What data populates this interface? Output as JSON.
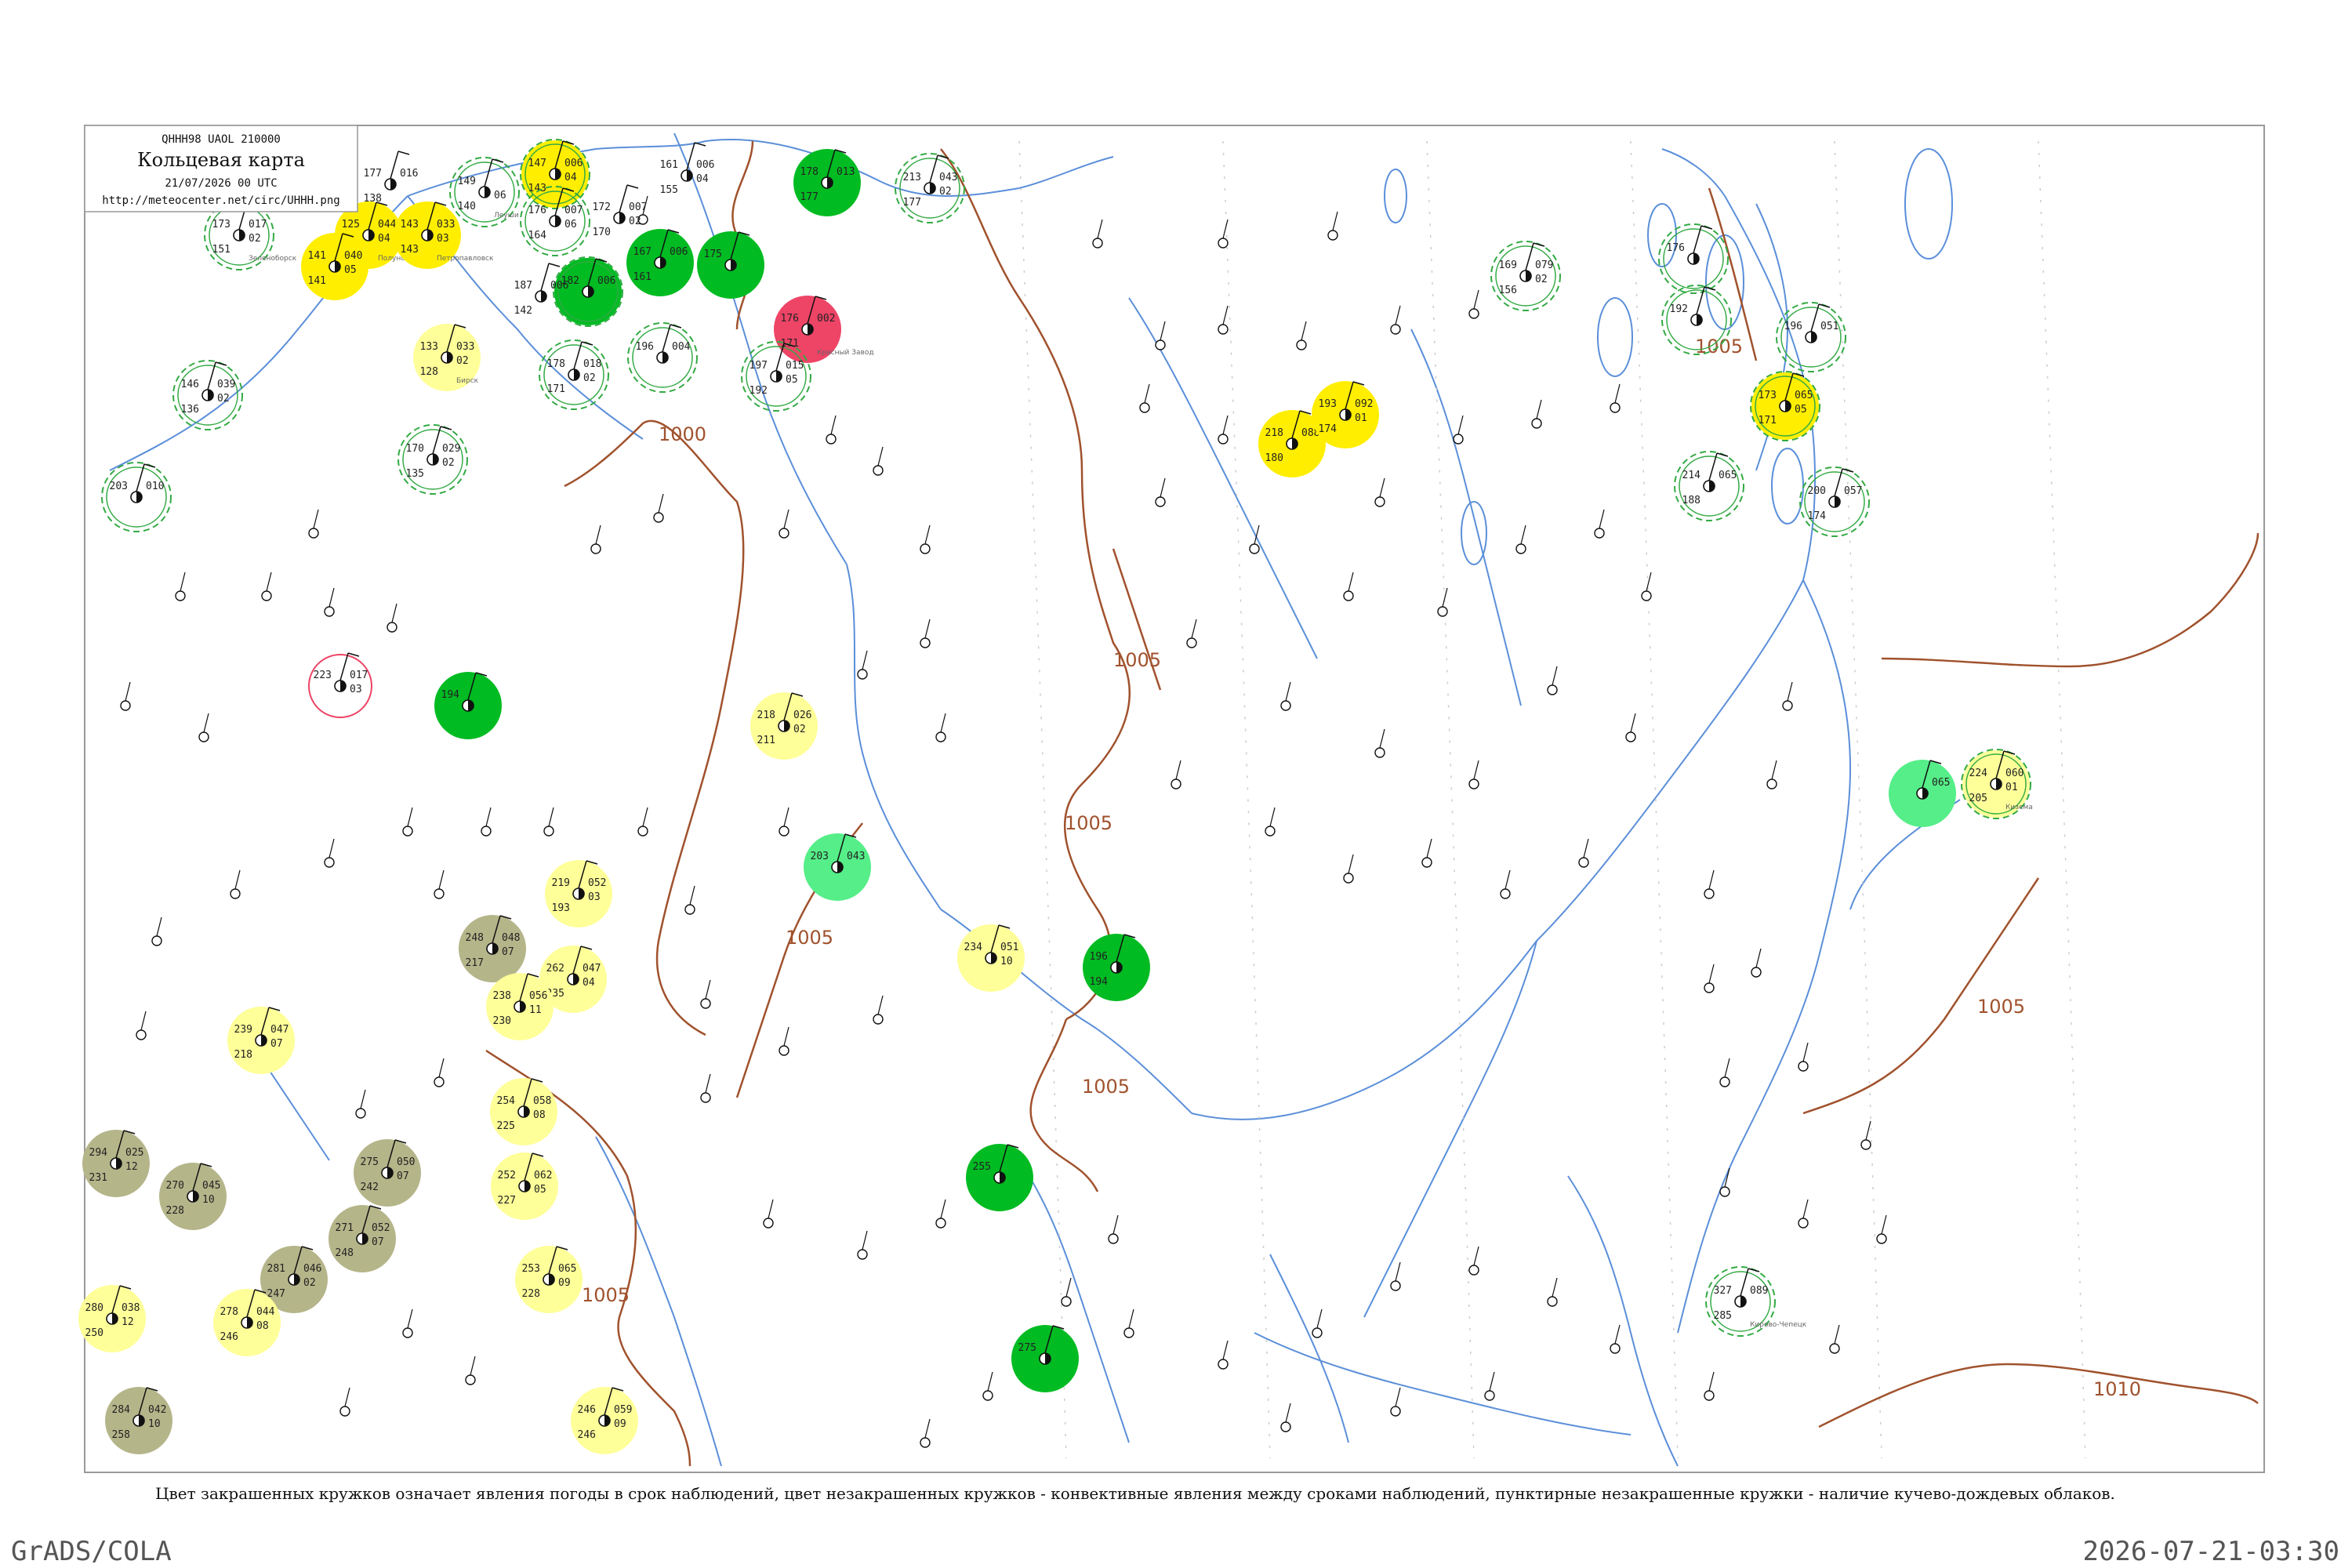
{
  "header": {
    "code_line": "QHHH98  UAOL  210000",
    "title": "Кольцевая карта",
    "valid": "21/07/2026 00 UTC",
    "url": "http://meteocenter.net/circ/UHHH.png"
  },
  "caption": "Цвет закрашенных кружков означает явления погоды в срок наблюдений, цвет незакрашенных кружков - конвективные явления между сроками наблюдений, пунктирные незакрашенные кружки - наличие кучево-дождевых облаков.",
  "footer": {
    "left": "GrADS/COLA",
    "right": "2026-07-21-03:30"
  },
  "colors": {
    "isobar": "#a0522d",
    "water": "#5b8fd9",
    "cb_ring": "#33aa44",
    "rain": "#00bb22",
    "shower": "#55ee88",
    "fog": "#ffee00",
    "haze": "#ffff99",
    "smoke": "#b5b58a",
    "storm": "#ee4466",
    "frame": "#999999"
  },
  "isobar_labels": [
    "1000",
    "1005",
    "1005",
    "1005",
    "1005",
    "1005",
    "1005",
    "1005",
    "1010"
  ],
  "stations": [
    {
      "name": "Зеленоборск",
      "t": "173",
      "td": "151",
      "p": "017",
      "dp": "02",
      "fill": "none",
      "ring": "cb"
    },
    {
      "name": "Полуночное",
      "t": "125",
      "td": "125",
      "p": "044",
      "dp": "04",
      "fill": "fog",
      "ring": ""
    },
    {
      "name": "Петропавловск",
      "t": "143",
      "td": "143",
      "p": "033",
      "dp": "03",
      "fill": "fog",
      "ring": ""
    },
    {
      "name": "",
      "t": "177",
      "td": "138",
      "p": "016",
      "dp": "",
      "fill": "none",
      "ring": ""
    },
    {
      "name": "Леуши",
      "t": "149",
      "td": "140",
      "p": "",
      "dp": "06",
      "fill": "none",
      "ring": "cb"
    },
    {
      "name": "",
      "t": "147",
      "td": "143",
      "p": "006",
      "dp": "04",
      "fill": "fog",
      "ring": "cb"
    },
    {
      "name": "",
      "t": "161",
      "td": "155",
      "p": "006",
      "dp": "04",
      "fill": "none",
      "ring": ""
    },
    {
      "name": "",
      "t": "172",
      "td": "170",
      "p": "007",
      "dp": "02",
      "fill": "none",
      "ring": ""
    },
    {
      "name": "",
      "t": "176",
      "td": "164",
      "p": "007",
      "dp": "06",
      "fill": "none",
      "ring": "cb"
    },
    {
      "name": "",
      "t": "182",
      "td": "",
      "p": "006",
      "dp": "",
      "fill": "rain",
      "ring": "cb"
    },
    {
      "name": "",
      "t": "167",
      "td": "161",
      "p": "006",
      "dp": "",
      "fill": "rain",
      "ring": ""
    },
    {
      "name": "",
      "t": "175",
      "td": "",
      "p": "",
      "dp": "",
      "fill": "rain",
      "ring": ""
    },
    {
      "name": "",
      "t": "178",
      "td": "177",
      "p": "013",
      "dp": "",
      "fill": "rain",
      "ring": ""
    },
    {
      "name": "",
      "t": "213",
      "td": "177",
      "p": "043",
      "dp": "02",
      "fill": "none",
      "ring": "cb"
    },
    {
      "name": "Красный Завод",
      "t": "176",
      "td": "171",
      "p": "002",
      "dp": "",
      "fill": "storm",
      "ring": ""
    },
    {
      "name": "",
      "t": "197",
      "td": "192",
      "p": "015",
      "dp": "05",
      "fill": "none",
      "ring": "cb"
    },
    {
      "name": "",
      "t": "141",
      "td": "141",
      "p": "040",
      "dp": "05",
      "fill": "fog",
      "ring": ""
    },
    {
      "name": "",
      "t": "187",
      "td": "142",
      "p": "006",
      "dp": "",
      "fill": "none",
      "ring": ""
    },
    {
      "name": "Бирск",
      "t": "133",
      "td": "128",
      "p": "033",
      "dp": "02",
      "fill": "haze",
      "ring": ""
    },
    {
      "name": "",
      "t": "178",
      "td": "171",
      "p": "018",
      "dp": "02",
      "fill": "none",
      "ring": "cb"
    },
    {
      "name": "",
      "t": "196",
      "td": "",
      "p": "004",
      "dp": "",
      "fill": "none",
      "ring": "cb"
    },
    {
      "name": "",
      "t": "146",
      "td": "136",
      "p": "039",
      "dp": "02",
      "fill": "none",
      "ring": "cb"
    },
    {
      "name": "",
      "t": "170",
      "td": "135",
      "p": "029",
      "dp": "02",
      "fill": "none",
      "ring": "cb"
    },
    {
      "name": "",
      "t": "203",
      "td": "",
      "p": "010",
      "dp": "",
      "fill": "none",
      "ring": "cb"
    },
    {
      "name": "",
      "t": "223",
      "td": "",
      "p": "017",
      "dp": "03",
      "fill": "none",
      "ring": "storm"
    },
    {
      "name": "",
      "t": "194",
      "td": "",
      "p": "",
      "dp": "",
      "fill": "rain",
      "ring": ""
    },
    {
      "name": "",
      "t": "218",
      "td": "211",
      "p": "026",
      "dp": "02",
      "fill": "haze",
      "ring": ""
    },
    {
      "name": "",
      "t": "203",
      "td": "",
      "p": "043",
      "dp": "",
      "fill": "shower",
      "ring": ""
    },
    {
      "name": "",
      "t": "219",
      "td": "193",
      "p": "052",
      "dp": "03",
      "fill": "haze",
      "ring": ""
    },
    {
      "name": "",
      "t": "248",
      "td": "217",
      "p": "048",
      "dp": "07",
      "fill": "smoke",
      "ring": ""
    },
    {
      "name": "",
      "t": "262",
      "td": "235",
      "p": "047",
      "dp": "04",
      "fill": "haze",
      "ring": ""
    },
    {
      "name": "",
      "t": "238",
      "td": "230",
      "p": "056",
      "dp": "11",
      "fill": "haze",
      "ring": ""
    },
    {
      "name": "",
      "t": "254",
      "td": "225",
      "p": "058",
      "dp": "08",
      "fill": "haze",
      "ring": ""
    },
    {
      "name": "",
      "t": "239",
      "td": "218",
      "p": "047",
      "dp": "07",
      "fill": "haze",
      "ring": ""
    },
    {
      "name": "",
      "t": "294",
      "td": "231",
      "p": "025",
      "dp": "12",
      "fill": "smoke",
      "ring": ""
    },
    {
      "name": "",
      "t": "270",
      "td": "228",
      "p": "045",
      "dp": "10",
      "fill": "smoke",
      "ring": ""
    },
    {
      "name": "",
      "t": "275",
      "td": "242",
      "p": "050",
      "dp": "07",
      "fill": "smoke",
      "ring": ""
    },
    {
      "name": "",
      "t": "271",
      "td": "248",
      "p": "052",
      "dp": "07",
      "fill": "smoke",
      "ring": ""
    },
    {
      "name": "",
      "t": "252",
      "td": "227",
      "p": "062",
      "dp": "05",
      "fill": "haze",
      "ring": ""
    },
    {
      "name": "",
      "t": "281",
      "td": "247",
      "p": "046",
      "dp": "02",
      "fill": "smoke",
      "ring": ""
    },
    {
      "name": "",
      "t": "253",
      "td": "228",
      "p": "065",
      "dp": "09",
      "fill": "haze",
      "ring": ""
    },
    {
      "name": "",
      "t": "280",
      "td": "250",
      "p": "038",
      "dp": "12",
      "fill": "haze",
      "ring": ""
    },
    {
      "name": "",
      "t": "278",
      "td": "246",
      "p": "044",
      "dp": "08",
      "fill": "haze",
      "ring": ""
    },
    {
      "name": "",
      "t": "284",
      "td": "258",
      "p": "042",
      "dp": "10",
      "fill": "smoke",
      "ring": ""
    },
    {
      "name": "",
      "t": "246",
      "td": "246",
      "p": "059",
      "dp": "09",
      "fill": "haze",
      "ring": ""
    },
    {
      "name": "",
      "t": "234",
      "td": "",
      "p": "051",
      "dp": "10",
      "fill": "haze",
      "ring": ""
    },
    {
      "name": "",
      "t": "196",
      "td": "194",
      "p": "",
      "dp": "",
      "fill": "rain",
      "ring": ""
    },
    {
      "name": "",
      "t": "255",
      "td": "",
      "p": "",
      "dp": "",
      "fill": "rain",
      "ring": ""
    },
    {
      "name": "",
      "t": "275",
      "td": "",
      "p": "",
      "dp": "",
      "fill": "rain",
      "ring": ""
    },
    {
      "name": "",
      "t": "218",
      "td": "180",
      "p": "088",
      "dp": "",
      "fill": "fog",
      "ring": ""
    },
    {
      "name": "",
      "t": "193",
      "td": "174",
      "p": "092",
      "dp": "01",
      "fill": "fog",
      "ring": ""
    },
    {
      "name": "",
      "t": "169",
      "td": "156",
      "p": "079",
      "dp": "02",
      "fill": "none",
      "ring": "cb"
    },
    {
      "name": "",
      "t": "176",
      "td": "",
      "p": "",
      "dp": "",
      "fill": "none",
      "ring": "cb"
    },
    {
      "name": "",
      "t": "192",
      "td": "",
      "p": "",
      "dp": "",
      "fill": "none",
      "ring": "cb"
    },
    {
      "name": "",
      "t": "196",
      "td": "",
      "p": "051",
      "dp": "",
      "fill": "none",
      "ring": "cb"
    },
    {
      "name": "",
      "t": "173",
      "td": "171",
      "p": "065",
      "dp": "05",
      "fill": "fog",
      "ring": "cb"
    },
    {
      "name": "",
      "t": "214",
      "td": "188",
      "p": "065",
      "dp": "",
      "fill": "none",
      "ring": "cb"
    },
    {
      "name": "",
      "t": "200",
      "td": "174",
      "p": "057",
      "dp": "",
      "fill": "none",
      "ring": "cb"
    },
    {
      "name": "",
      "t": "",
      "td": "",
      "p": "065",
      "dp": "",
      "fill": "shower",
      "ring": ""
    },
    {
      "name": "Кизема",
      "t": "224",
      "td": "205",
      "p": "060",
      "dp": "01",
      "fill": "haze",
      "ring": "cb"
    },
    {
      "name": "Кирово-Чепецк",
      "t": "327",
      "td": "285",
      "p": "089",
      "dp": "",
      "fill": "none",
      "ring": "cb"
    }
  ]
}
